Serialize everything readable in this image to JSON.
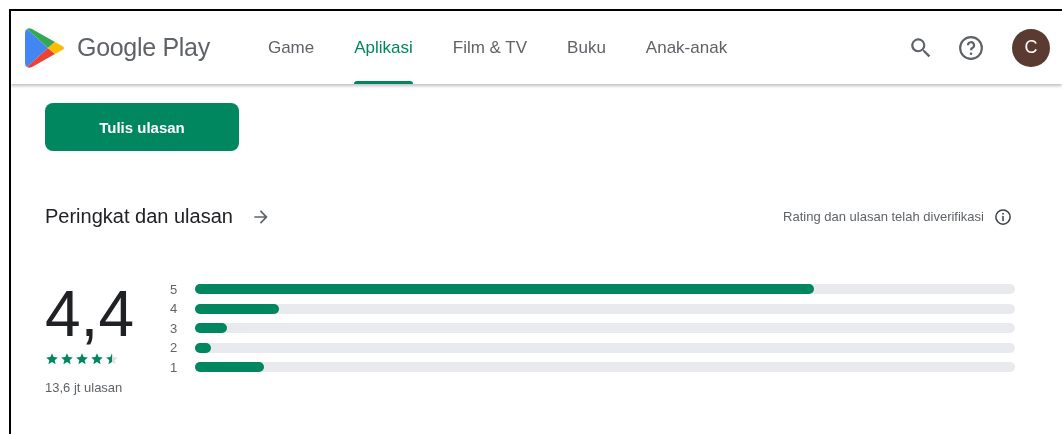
{
  "header": {
    "brand": "Google Play",
    "nav": [
      {
        "label": "Game",
        "selected": false
      },
      {
        "label": "Aplikasi",
        "selected": true
      },
      {
        "label": "Film & TV",
        "selected": false
      },
      {
        "label": "Buku",
        "selected": false
      },
      {
        "label": "Anak-anak",
        "selected": false
      }
    ],
    "avatar": "C"
  },
  "write_review_button": "Tulis ulasan",
  "section": {
    "title": "Peringkat dan ulasan",
    "note": "Rating dan ulasan telah diverifikasi"
  },
  "rating": {
    "score": "4,4",
    "stars": 4.5,
    "count": "13,6 jt ulasan"
  },
  "histogram": [
    {
      "label": "5",
      "level": 0.755
    },
    {
      "label": "4",
      "level": 0.102
    },
    {
      "label": "3",
      "level": 0.039
    },
    {
      "label": "2",
      "level": 0.02
    },
    {
      "label": "1",
      "level": 0.084
    }
  ]
}
